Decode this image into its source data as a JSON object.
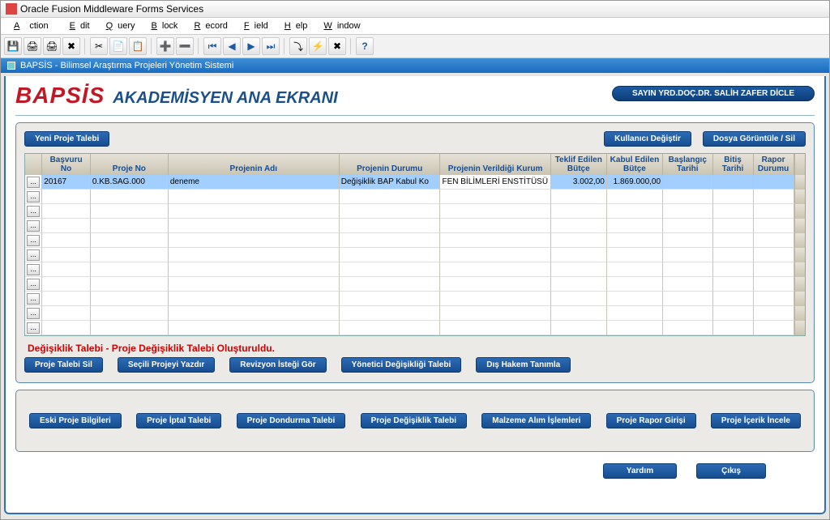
{
  "window": {
    "title": "Oracle Fusion Middleware Forms Services"
  },
  "menu": {
    "action": "Action",
    "edit": "Edit",
    "query": "Query",
    "block": "Block",
    "record": "Record",
    "field": "Field",
    "help": "Help",
    "window": "Window"
  },
  "subwindow": {
    "title": "BAPSİS - Bilimsel Araştırma Projeleri Yönetim Sistemi"
  },
  "header": {
    "brand": "BAPSİS",
    "page_title": "AKADEMİSYEN ANA EKRANI",
    "user": "SAYIN YRD.DOÇ.DR. SALİH ZAFER DİCLE"
  },
  "topbar": {
    "yeni": "Yeni Proje Talebi",
    "kdeg": "Kullanıcı Değiştir",
    "dosya": "Dosya Görüntüle / Sil"
  },
  "columns": {
    "basvuru": "Başvuru No",
    "proje_no": "Proje No",
    "proje_adi": "Projenin Adı",
    "durum": "Projenin Durumu",
    "kurum": "Projenin Verildiği Kurum",
    "teklif": "Teklif Edilen Bütçe",
    "kabul": "Kabul Edilen Bütçe",
    "baslangic": "Başlangıç Tarihi",
    "bitis": "Bitiş Tarihi",
    "rapor": "Rapor Durumu",
    "ellipsis": "..."
  },
  "row1": {
    "basvuru": "20167",
    "proje_no": "0.KB.SAG.000",
    "proje_adi": "deneme",
    "durum": "Değişiklik BAP Kabul Ko",
    "kurum": "FEN BİLİMLERİ ENSTİTÜSÜ",
    "teklif": "3.002,00",
    "kabul": "1.869.000,00",
    "baslangic": "",
    "bitis": "",
    "rapor": ""
  },
  "status": "Değişiklik Talebi  -  Proje Değişiklik Talebi Oluşturuldu.",
  "rowbtns": {
    "sil": "Proje Talebi Sil",
    "yazdir": "Seçili Projeyi Yazdır",
    "revizyon": "Revizyon İsteği Gör",
    "yonetici": "Yönetici Değişikliği Talebi",
    "hakem": "Dış Hakem Tanımla"
  },
  "panel2": {
    "eski": "Eski Proje Bilgileri",
    "iptal": "Proje İptal Talebi",
    "dondurma": "Proje Dondurma Talebi",
    "degisiklik": "Proje Değişiklik Talebi",
    "malzeme": "Malzeme Alım İşlemleri",
    "rapor": "Proje Rapor Girişi",
    "icerik": "Proje İçerik İncele"
  },
  "footer": {
    "yardim": "Yardım",
    "cikis": "Çıkış"
  },
  "toolbar_icons": {
    "save": "💾",
    "print": "🖨",
    "exit": "✖",
    "cut": "✂",
    "copy": "📄",
    "paste": "📋",
    "new": "➕",
    "del": "➖",
    "first": "⏮",
    "prev": "◀",
    "next": "▶",
    "last": "⏭",
    "enter": "⤵",
    "exec": "⚡",
    "cancel": "✖",
    "edit": "✎",
    "lov": "☰",
    "help": "?"
  }
}
